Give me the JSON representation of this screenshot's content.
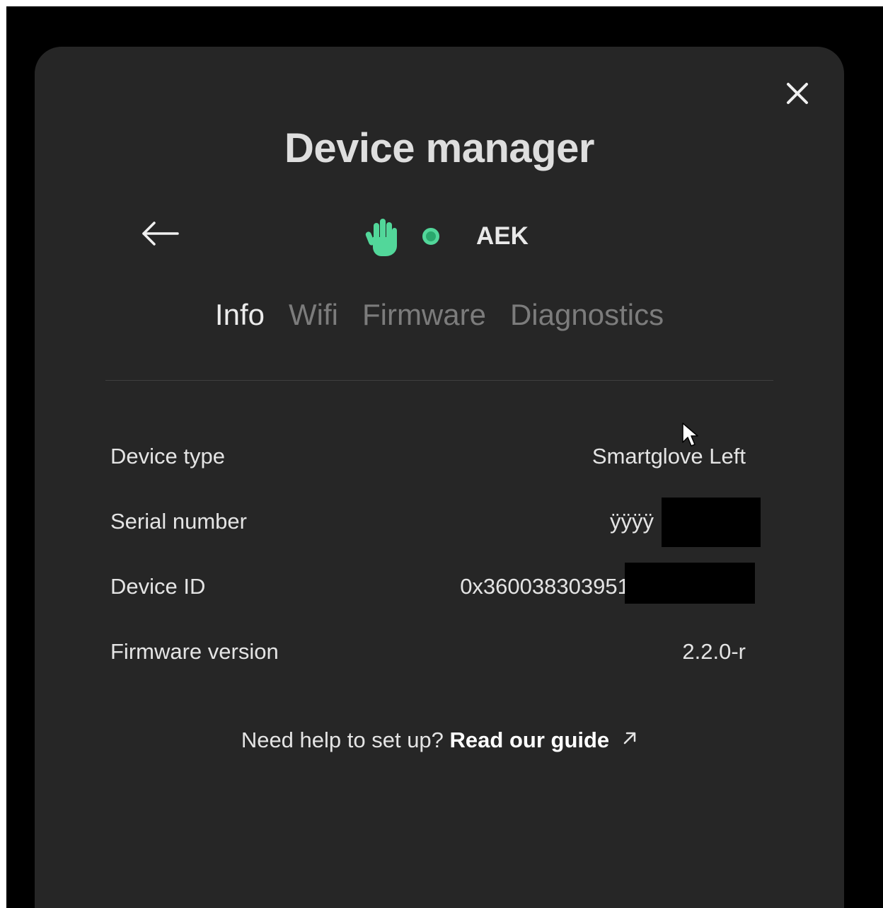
{
  "dialog": {
    "title": "Device manager",
    "close_icon": "close-icon",
    "back_icon": "arrow-left-icon"
  },
  "device": {
    "icon": "hand-icon",
    "status_color": "#52d79a",
    "name": "AEK"
  },
  "tabs": [
    {
      "label": "Info",
      "active": true
    },
    {
      "label": "Wifi",
      "active": false
    },
    {
      "label": "Firmware",
      "active": false
    },
    {
      "label": "Diagnostics",
      "active": false
    }
  ],
  "info": [
    {
      "label": "Device type",
      "value": "Smartglove Left"
    },
    {
      "label": "Serial number",
      "value": "ÿÿÿÿ"
    },
    {
      "label": "Device ID",
      "value": "0x3600383039510F"
    },
    {
      "label": "Firmware version",
      "value": "2.2.0-r"
    }
  ],
  "help": {
    "prefix": "Need help to set up?",
    "link_label": "Read our guide",
    "link_icon": "external-link-icon"
  },
  "colors": {
    "background": "#000000",
    "panel": "#262626",
    "accent": "#52d79a",
    "inactive_tab": "#7c7c7c"
  }
}
